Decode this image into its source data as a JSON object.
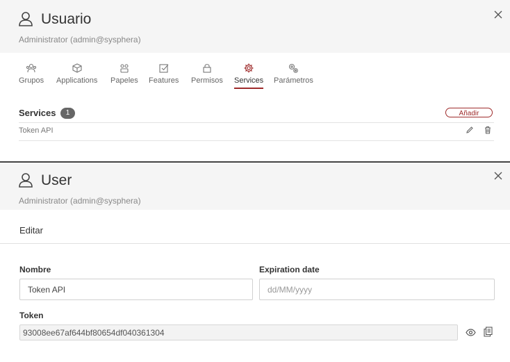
{
  "back_panel": {
    "title": "Usuario",
    "subtitle": "Administrator (admin@sysphera)",
    "tabs": [
      {
        "label": "Grupos",
        "icon": "groups-icon"
      },
      {
        "label": "Applications",
        "icon": "cube-icon"
      },
      {
        "label": "Papeles",
        "icon": "roles-icon"
      },
      {
        "label": "Features",
        "icon": "checkbox-icon"
      },
      {
        "label": "Permisos",
        "icon": "lock-icon"
      },
      {
        "label": "Services",
        "icon": "gear-icon",
        "active": true
      },
      {
        "label": "Parámetros",
        "icon": "gears-icon"
      }
    ],
    "services": {
      "title": "Services",
      "count": "1",
      "add_label": "Añadir",
      "rows": [
        {
          "name": "Token API"
        }
      ]
    }
  },
  "front_panel": {
    "title": "User",
    "subtitle": "Administrator (admin@sysphera)",
    "section": "Editar",
    "fields": {
      "name_label": "Nombre",
      "name_value": "Token API",
      "expiration_label": "Expiration date",
      "expiration_placeholder": "dd/MM/yyyy",
      "token_label": "Token",
      "token_value": "93008ee67af644bf80654df040361304"
    }
  },
  "colors": {
    "accent": "#9e2a2a",
    "header_bg": "#f5f5f5",
    "badge_bg": "#666666"
  }
}
